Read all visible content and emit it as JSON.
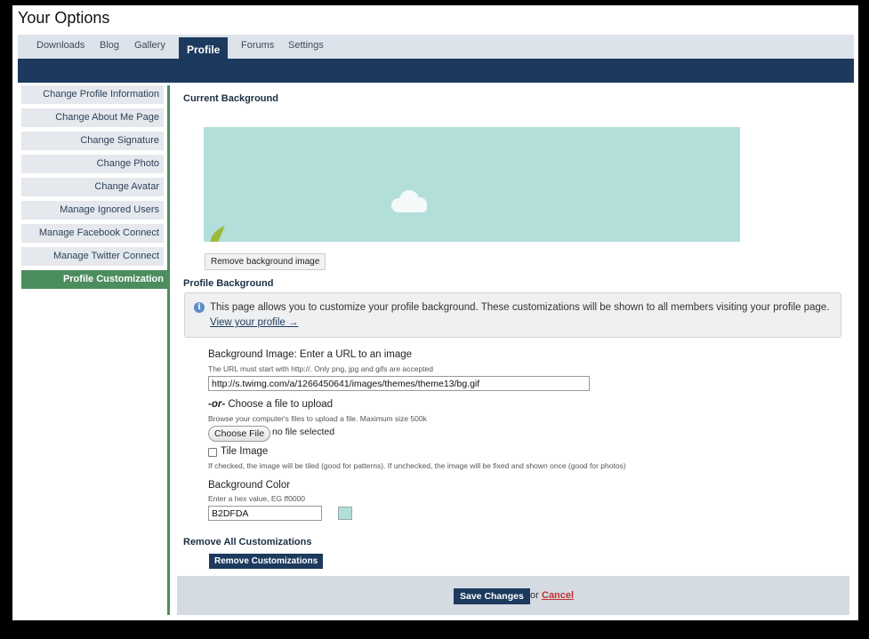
{
  "page": {
    "title": "Your Options"
  },
  "tabs": [
    {
      "label": "Downloads"
    },
    {
      "label": "Blog"
    },
    {
      "label": "Gallery"
    },
    {
      "label": "Profile",
      "active": true
    },
    {
      "label": "Forums"
    },
    {
      "label": "Settings"
    }
  ],
  "sidebar": {
    "items": [
      {
        "label": "Change Profile Information"
      },
      {
        "label": "Change About Me Page"
      },
      {
        "label": "Change Signature"
      },
      {
        "label": "Change Photo"
      },
      {
        "label": "Change Avatar"
      },
      {
        "label": "Manage Ignored Users"
      },
      {
        "label": "Manage Facebook Connect"
      },
      {
        "label": "Manage Twitter Connect"
      },
      {
        "label": "Profile Customization",
        "active": true
      }
    ]
  },
  "current_background": {
    "heading": "Current Background",
    "preview_color": "#B2DFDA",
    "remove_button": "Remove background image"
  },
  "profile_background": {
    "heading": "Profile Background",
    "info_icon": "info-icon",
    "info_text": "This page allows you to customize your profile background. These customizations will be shown to all members visiting your profile page.",
    "info_link": "View your profile →",
    "image_url": {
      "label": "Background Image: Enter a URL to an image",
      "hint": "The URL must start with http://. Only png, jpg and gifs are accepted",
      "value": "http://s.twimg.com/a/1266450641/images/themes/theme13/bg.gif"
    },
    "upload": {
      "or_prefix": "-or-",
      "label": " Choose a file to upload",
      "hint": "Browse your computer's files to upload a file. Maximum size 500k",
      "button": "Choose File",
      "status": "no file selected"
    },
    "tile": {
      "label": "Tile Image",
      "checked": false,
      "hint": "If checked, the image will be tiled (good for patterns). If unchecked, the image will be fixed and shown once (good for photos)"
    },
    "color": {
      "label": "Background Color",
      "hint": "Enter a hex value, EG ff0000",
      "value": "B2DFDA",
      "swatch": "#B2DFDA"
    }
  },
  "remove_all": {
    "heading": "Remove All Customizations",
    "button": "Remove Customizations"
  },
  "footer": {
    "save_button": "Save Changes",
    "or_text": "or",
    "cancel_link": "Cancel"
  },
  "colors": {
    "nav_dark": "#1C3A5E",
    "accent_green": "#4C8D5E",
    "cancel_red": "#C0302D"
  }
}
